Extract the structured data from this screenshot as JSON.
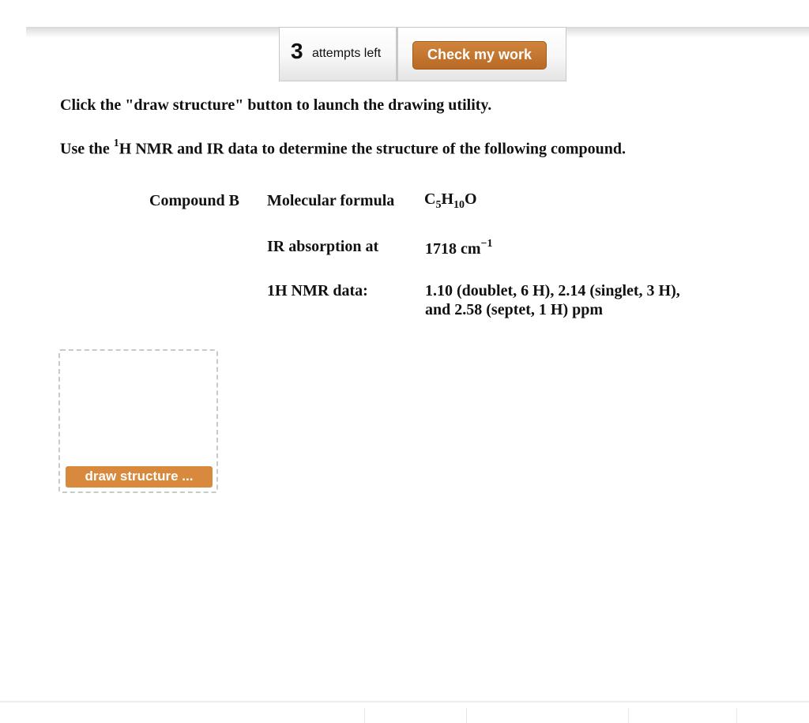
{
  "toolbar": {
    "attempts_count": "3",
    "attempts_label": "attempts left",
    "check_button_label": "Check my work"
  },
  "instructions": {
    "line1": "Click the \"draw structure\" button to launch the drawing utility.",
    "line2_prefix": "Use the ",
    "line2_sup": "1",
    "line2_suffix": "H NMR and IR data to determine the structure of the following compound."
  },
  "compound": {
    "name": "Compound B",
    "rows": [
      {
        "label": "Molecular formula",
        "value_parts": {
          "c": "C",
          "c_sub": "5",
          "h": "H",
          "h_sub": "10",
          "o": "O"
        }
      },
      {
        "label": "IR absorption at",
        "value_number": "1718 cm",
        "value_sup": "−1"
      },
      {
        "label": "1H NMR data:",
        "value": "1.10 (doublet, 6 H), 2.14 (singlet, 3 H), and 2.58 (septet, 1 H) ppm"
      }
    ]
  },
  "drawing": {
    "button_label": "draw structure ..."
  },
  "colors": {
    "check_button": "#c27630",
    "draw_button": "#d8893d",
    "dashed_border": "#c9c9c9"
  }
}
